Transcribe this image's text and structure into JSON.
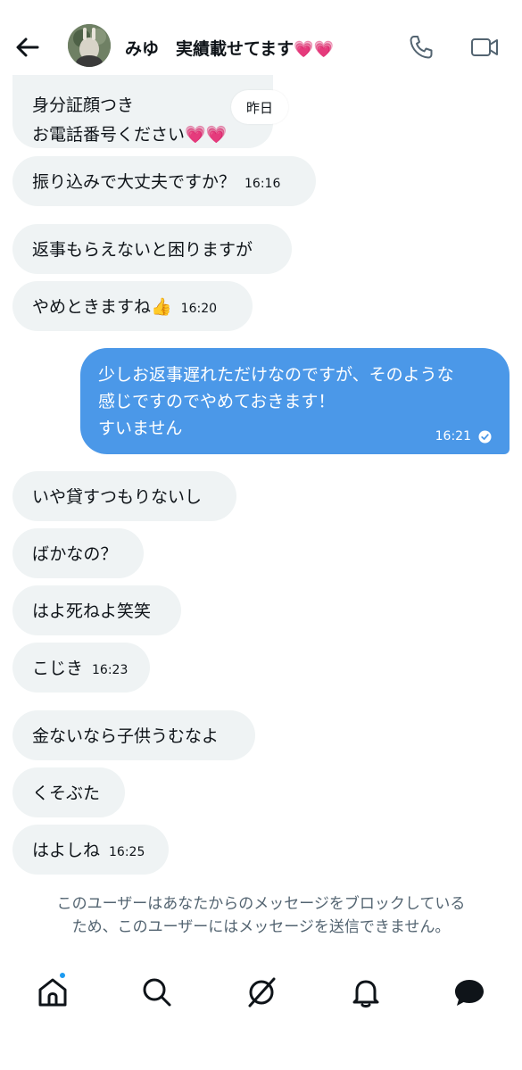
{
  "header": {
    "name": "みゆ",
    "status": "実績載せてます",
    "hearts": "💗💗"
  },
  "chat": {
    "day_badge": "昨日",
    "messages": [
      {
        "line1": "身分証顔つき",
        "line2": "お電話番号ください",
        "hearts": "💗💗"
      },
      {
        "text": "振り込みで大丈夫ですか？",
        "time": "16:16"
      },
      {
        "text": "返事もらえないと困りますが"
      },
      {
        "text": "やめときますね👍",
        "time": "16:20"
      },
      {
        "line1": "少しお返事遅れただけなのですが、そのような",
        "line2": "感じですのでやめておきます！",
        "line3": "すいません",
        "time": "16:21"
      },
      {
        "text": "いや貸すつもりないし"
      },
      {
        "text": "ばかなの？"
      },
      {
        "text": "はよ死ねよ笑笑"
      },
      {
        "text": "こじき",
        "time": "16:23"
      },
      {
        "text": "金ないなら子供うむなよ"
      },
      {
        "text": "くそぶた"
      },
      {
        "text": "はよしね",
        "time": "16:25"
      }
    ]
  },
  "blocked_notice": {
    "line1": "このユーザーはあなたからのメッセージをブロックしている",
    "line2": "ため、このユーザーにはメッセージを送信できません。"
  },
  "colors": {
    "outgoing_bubble": "#4b98e8",
    "incoming_bubble": "#eff3f4",
    "notification_dot": "#1d9bf0"
  }
}
